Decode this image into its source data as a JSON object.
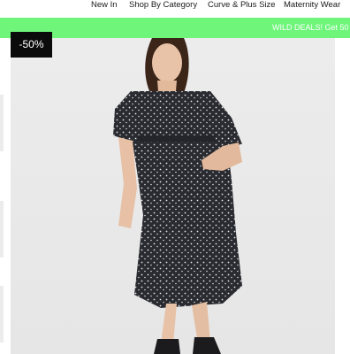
{
  "nav": {
    "items": [
      {
        "label": "New In"
      },
      {
        "label": "Shop By Category"
      },
      {
        "label": "Curve & Plus Size"
      },
      {
        "label": "Maternity Wear"
      }
    ]
  },
  "promo": {
    "text": "WILD DEALS! Get 50",
    "background": "#6ef57a"
  },
  "product": {
    "discount_badge": "-50%",
    "image_icon": "product-photo"
  }
}
